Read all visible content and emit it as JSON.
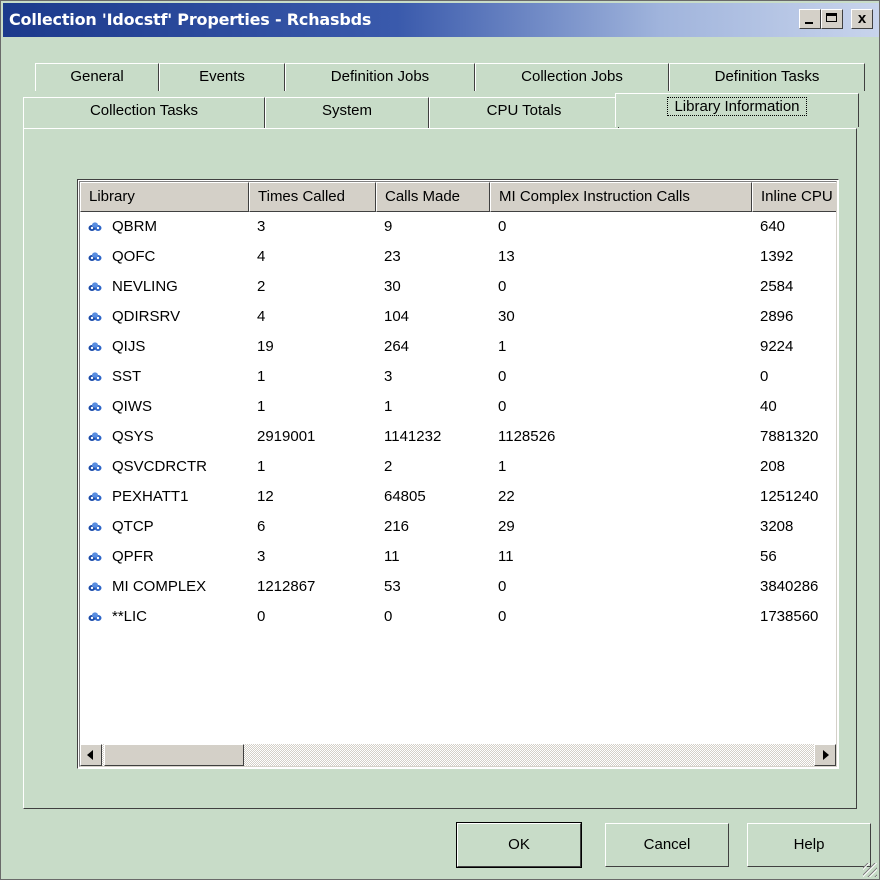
{
  "window": {
    "title": "Collection 'Idocstf' Properties - Rchasbds",
    "minimize_icon": "minimize-icon",
    "maximize_icon": "maximize-icon",
    "close_label": "x"
  },
  "tabs_row1": [
    {
      "label": "General"
    },
    {
      "label": "Events"
    },
    {
      "label": "Definition Jobs"
    },
    {
      "label": "Collection Jobs"
    },
    {
      "label": "Definition Tasks"
    }
  ],
  "tabs_row2": [
    {
      "label": "Collection Tasks"
    },
    {
      "label": "System"
    },
    {
      "label": "CPU Totals"
    },
    {
      "label": "Library Information",
      "active": true
    }
  ],
  "table": {
    "columns": [
      "Library",
      "Times Called",
      "Calls Made",
      "MI Complex Instruction Calls",
      "Inline CPU"
    ],
    "rows": [
      [
        "QBRM",
        "3",
        "9",
        "0",
        "640"
      ],
      [
        "QOFC",
        "4",
        "23",
        "13",
        "1392"
      ],
      [
        "NEVLING",
        "2",
        "30",
        "0",
        "2584"
      ],
      [
        "QDIRSRV",
        "4",
        "104",
        "30",
        "2896"
      ],
      [
        "QIJS",
        "19",
        "264",
        "1",
        "9224"
      ],
      [
        "SST",
        "1",
        "3",
        "0",
        "0"
      ],
      [
        "QIWS",
        "1",
        "1",
        "0",
        "40"
      ],
      [
        "QSYS",
        "2919001",
        "1141232",
        "1128526",
        "7881320"
      ],
      [
        "QSVCDRCTR",
        "1",
        "2",
        "1",
        "208"
      ],
      [
        "PEXHATT1",
        "12",
        "64805",
        "22",
        "1251240"
      ],
      [
        "QTCP",
        "6",
        "216",
        "29",
        "3208"
      ],
      [
        "QPFR",
        "3",
        "11",
        "11",
        "56"
      ],
      [
        "MI COMPLEX",
        "1212867",
        "53",
        "0",
        "3840286"
      ],
      [
        "**LIC",
        "0",
        "0",
        "0",
        "1738560"
      ]
    ],
    "row_icon": "library-icon"
  },
  "buttons": {
    "ok": "OK",
    "cancel": "Cancel",
    "help": "Help"
  }
}
